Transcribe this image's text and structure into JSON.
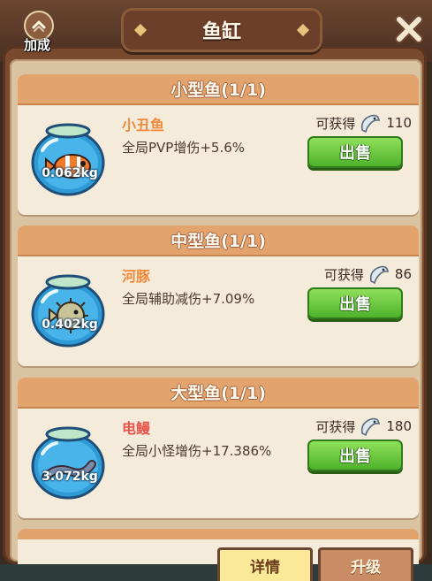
{
  "window": {
    "title": "鱼缸",
    "bonus_label": "加成"
  },
  "cards": [
    {
      "category": "小型鱼(1/1)",
      "name": "小丑鱼",
      "name_color": "#f08a3a",
      "effect": "全局PVP增伤+5.6%",
      "reward_label": "可获得",
      "reward_amount": "110",
      "weight": "0.062kg",
      "sell_label": "出售",
      "fish_icon": "clownfish-icon"
    },
    {
      "category": "中型鱼(1/1)",
      "name": "河豚",
      "name_color": "#f08a3a",
      "effect": "全局辅助减伤+7.09%",
      "reward_label": "可获得",
      "reward_amount": "86",
      "weight": "0.402kg",
      "sell_label": "出售",
      "fish_icon": "pufferfish-icon"
    },
    {
      "category": "大型鱼(1/1)",
      "name": "电鳗",
      "name_color": "#e8534a",
      "effect": "全局小怪增伤+17.386%",
      "reward_label": "可获得",
      "reward_amount": "180",
      "weight": "3.072kg",
      "sell_label": "出售",
      "fish_icon": "electric-eel-icon"
    }
  ],
  "tabs": {
    "details": "详情",
    "upgrade": "升级"
  },
  "colors": {
    "header": "#e2a36c",
    "sell_button": "#5cc233",
    "card_bg": "#f4ebda"
  }
}
